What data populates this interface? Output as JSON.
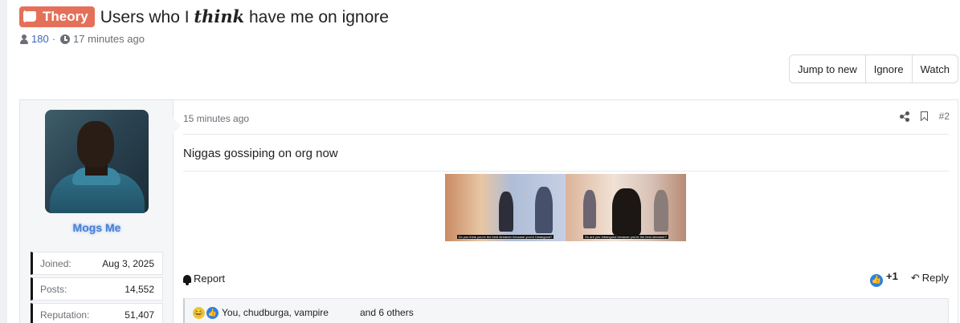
{
  "thread": {
    "prefix": "Theory",
    "title_before": "Users who I ",
    "title_emphasis": "think",
    "title_after": " have me on ignore",
    "starter": "180",
    "separator": "·",
    "started": "17 minutes ago"
  },
  "thread_actions": {
    "jump_to_new": "Jump to new",
    "ignore": "Ignore",
    "watch": "Watch"
  },
  "post": {
    "user": {
      "name": "Mogs Me",
      "stats": [
        {
          "label": "Joined:",
          "value": "Aug 3, 2025"
        },
        {
          "label": "Posts:",
          "value": "14,552"
        },
        {
          "label": "Reputation:",
          "value": "51,407"
        }
      ]
    },
    "time": "15 minutes ago",
    "number": "#2",
    "body": "Niggas gossiping on org now",
    "images": [
      {
        "caption": "Do you think you're the best streamer because you're Inbangood?"
      },
      {
        "caption": "So are you Inbangood because you're the best streamer?"
      }
    ],
    "report": "Report",
    "score": "+1",
    "reply": "Reply",
    "reactions": {
      "users": "You, chudburga, vampire",
      "others": "and 6 others"
    }
  },
  "colors": {
    "prefix": "#e4705a",
    "link": "#3b67b3",
    "username": "#4a7fd0",
    "like": "#2f7fe0"
  },
  "icons": [
    "scroll-icon",
    "person-icon",
    "clock-icon",
    "share-icon",
    "bookmark-icon",
    "bell-icon",
    "like-icon",
    "reply-icon",
    "laugh-icon"
  ]
}
